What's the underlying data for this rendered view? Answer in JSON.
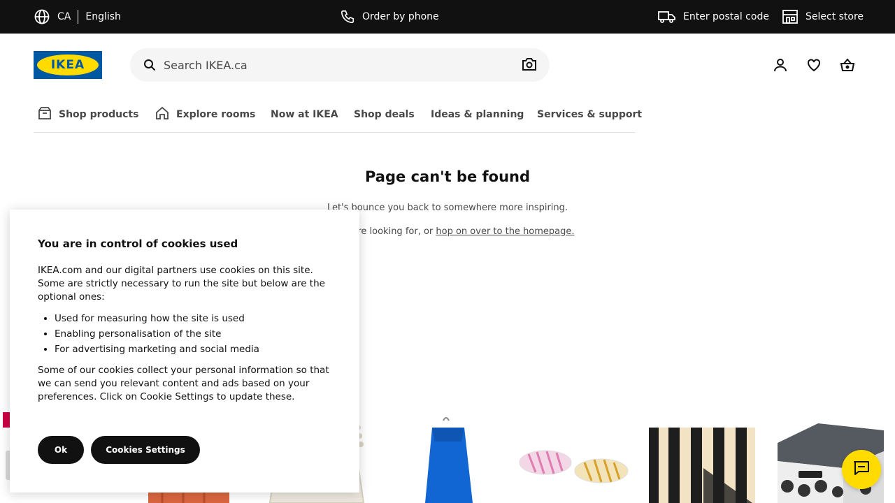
{
  "topbar": {
    "country": "CA",
    "language": "English",
    "order_by_phone": "Order by phone",
    "postal_code": "Enter postal code",
    "select_store": "Select store"
  },
  "header": {
    "logo_text": "IKEA",
    "search_placeholder": "Search IKEA.ca"
  },
  "nav": {
    "items": [
      {
        "label": "Shop products",
        "icon": "box-icon"
      },
      {
        "label": "Explore rooms",
        "icon": "house-icon"
      },
      {
        "label": "Now at IKEA"
      },
      {
        "label": "Shop deals"
      },
      {
        "label": "Ideas & planning"
      },
      {
        "label": "Services & support"
      }
    ]
  },
  "main": {
    "title": "Page can't be found",
    "line1": "Let's bounce you back to somewhere more inspiring.",
    "line2_prefix": "hat you're looking for, or ",
    "line2_link": "hop on over to the homepage."
  },
  "cookie": {
    "title": "You are in control of cookies used",
    "intro": "IKEA.com and our digital partners use cookies on this site. Some are strictly necessary to run the site but below are the optional ones:",
    "items": [
      "Used for measuring how the site is used",
      "Enabling personalisation of the site",
      "For advertising marketing and social media"
    ],
    "outro": "Some of our cookies collect your personal information so that we can send you relevant content and ads based on your preferences. Click on Cookie Settings to update these.",
    "ok_label": "Ok",
    "settings_label": "Cookies Settings"
  },
  "colors": {
    "brand_blue": "#0058a3",
    "brand_yellow": "#ffdb00",
    "topbar_bg": "#111111"
  }
}
